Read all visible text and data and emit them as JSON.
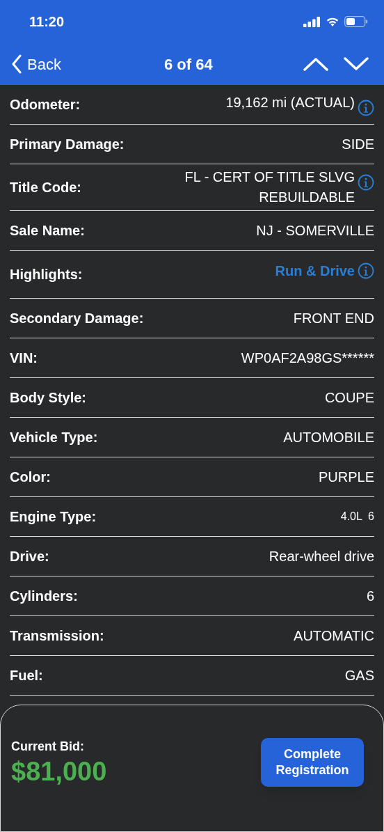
{
  "status_bar": {
    "time": "11:20"
  },
  "nav": {
    "back": "Back",
    "title": "6 of 64"
  },
  "details": [
    {
      "label": "Odometer:",
      "value": "19,162 mi (ACTUAL)",
      "kind": "info"
    },
    {
      "label": "Primary Damage:",
      "value": "SIDE",
      "kind": "text"
    },
    {
      "label": "Title Code:",
      "value": "FL - CERT OF TITLE SLVG REBUILDABLE",
      "kind": "info"
    },
    {
      "label": "Sale Name:",
      "value": "NJ - SOMERVILLE",
      "kind": "text"
    },
    {
      "label": "Highlights:",
      "value": "Run & Drive",
      "kind": "highlight"
    },
    {
      "label": "Secondary Damage:",
      "value": "FRONT END",
      "kind": "text"
    },
    {
      "label": "VIN:",
      "value": "WP0AF2A98GS******",
      "kind": "text"
    },
    {
      "label": "Body Style:",
      "value": "COUPE",
      "kind": "text"
    },
    {
      "label": "Vehicle Type:",
      "value": "AUTOMOBILE",
      "kind": "text"
    },
    {
      "label": "Color:",
      "value": "PURPLE",
      "kind": "text"
    },
    {
      "label": "Engine Type:",
      "value": "4.0L  6",
      "kind": "small"
    },
    {
      "label": "Drive:",
      "value": "Rear-wheel drive",
      "kind": "text"
    },
    {
      "label": "Cylinders:",
      "value": "6",
      "kind": "text"
    },
    {
      "label": "Transmission:",
      "value": "AUTOMATIC",
      "kind": "text"
    },
    {
      "label": "Fuel:",
      "value": "GAS",
      "kind": "text"
    }
  ],
  "bid": {
    "label": "Current Bid:",
    "amount": "$81,000",
    "button": "Complete Registration"
  }
}
